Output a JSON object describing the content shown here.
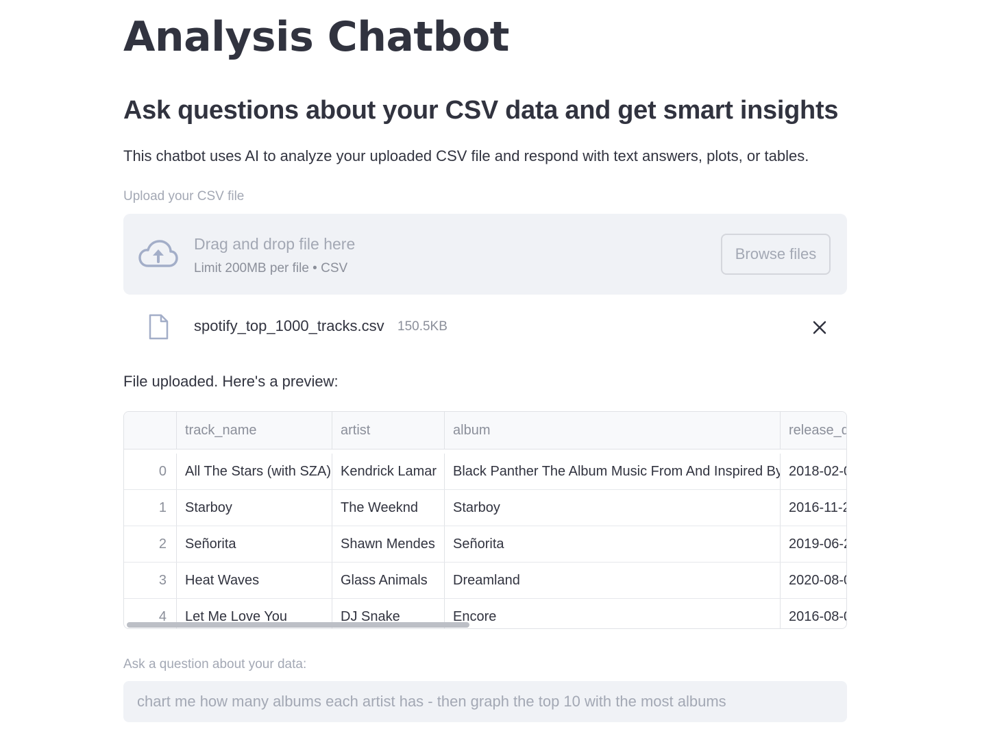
{
  "header": {
    "title": "Analysis Chatbot",
    "subtitle": "Ask questions about your CSV data and get smart insights",
    "description": "This chatbot uses AI to analyze your uploaded CSV file and respond with text answers, plots, or tables."
  },
  "uploader": {
    "label": "Upload your CSV file",
    "drop_text": "Drag and drop file here",
    "limit_text": "Limit 200MB per file • CSV",
    "browse_label": "Browse files",
    "file": {
      "name": "spotify_top_1000_tracks.csv",
      "size": "150.5KB"
    }
  },
  "preview": {
    "label": "File uploaded. Here's a preview:",
    "columns": [
      "",
      "track_name",
      "artist",
      "album",
      "release_d"
    ],
    "rows": [
      {
        "index": "0",
        "track_name": "All The Stars (with SZA)",
        "artist": "Kendrick Lamar",
        "album": "Black Panther The Album Music From And Inspired By",
        "release_date": "2018-02-0"
      },
      {
        "index": "1",
        "track_name": "Starboy",
        "artist": "The Weeknd",
        "album": "Starboy",
        "release_date": "2016-11-2"
      },
      {
        "index": "2",
        "track_name": "Señorita",
        "artist": "Shawn Mendes",
        "album": "Señorita",
        "release_date": "2019-06-2"
      },
      {
        "index": "3",
        "track_name": "Heat Waves",
        "artist": "Glass Animals",
        "album": "Dreamland",
        "release_date": "2020-08-0"
      },
      {
        "index": "4",
        "track_name": "Let Me Love You",
        "artist": "DJ Snake",
        "album": "Encore",
        "release_date": "2016-08-0"
      }
    ]
  },
  "question": {
    "label": "Ask a question about your data:",
    "value": "chart me how many albums each artist has - then graph the top 10 with the most albums"
  }
}
